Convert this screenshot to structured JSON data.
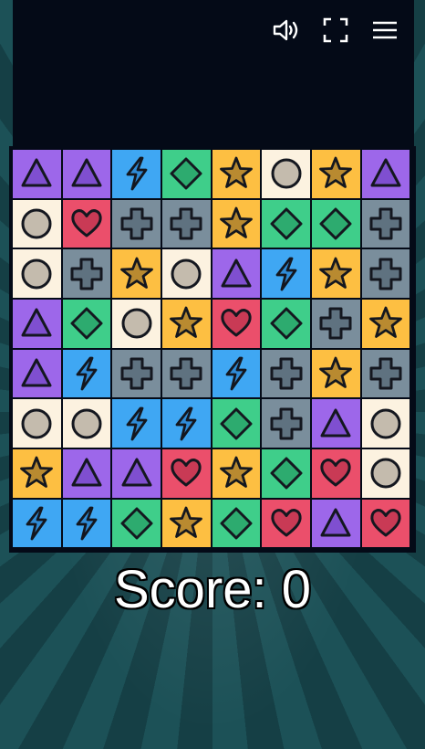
{
  "score": {
    "text": "Score: 0"
  },
  "toolbar": {
    "icons": [
      "speaker-volume-icon",
      "fullscreen-icon",
      "menu-hamburger-icon"
    ]
  },
  "colors": {
    "triangle": "#9d67ea",
    "heart": "#eb4f6b",
    "bolt": "#3fa7f3",
    "diamond": "#3fce8a",
    "star": "#fdbf42",
    "circle": "#fcf2e0",
    "cross": "#7a8e9c"
  },
  "board": {
    "rows": 8,
    "cols": 8,
    "cells": [
      [
        "triangle",
        "triangle",
        "bolt",
        "diamond",
        "star",
        "circle",
        "star",
        "triangle"
      ],
      [
        "circle",
        "heart",
        "cross",
        "cross",
        "star",
        "diamond",
        "diamond",
        "cross"
      ],
      [
        "circle",
        "cross",
        "star",
        "circle",
        "triangle",
        "bolt",
        "star",
        "cross"
      ],
      [
        "triangle",
        "diamond",
        "circle",
        "star",
        "heart",
        "diamond",
        "cross",
        "star"
      ],
      [
        "triangle",
        "bolt",
        "cross",
        "cross",
        "bolt",
        "cross",
        "star",
        "cross"
      ],
      [
        "circle",
        "circle",
        "bolt",
        "bolt",
        "diamond",
        "cross",
        "triangle",
        "circle"
      ],
      [
        "star",
        "triangle",
        "triangle",
        "heart",
        "star",
        "diamond",
        "heart",
        "circle"
      ],
      [
        "bolt",
        "bolt",
        "diamond",
        "star",
        "diamond",
        "heart",
        "triangle",
        "heart"
      ]
    ]
  }
}
